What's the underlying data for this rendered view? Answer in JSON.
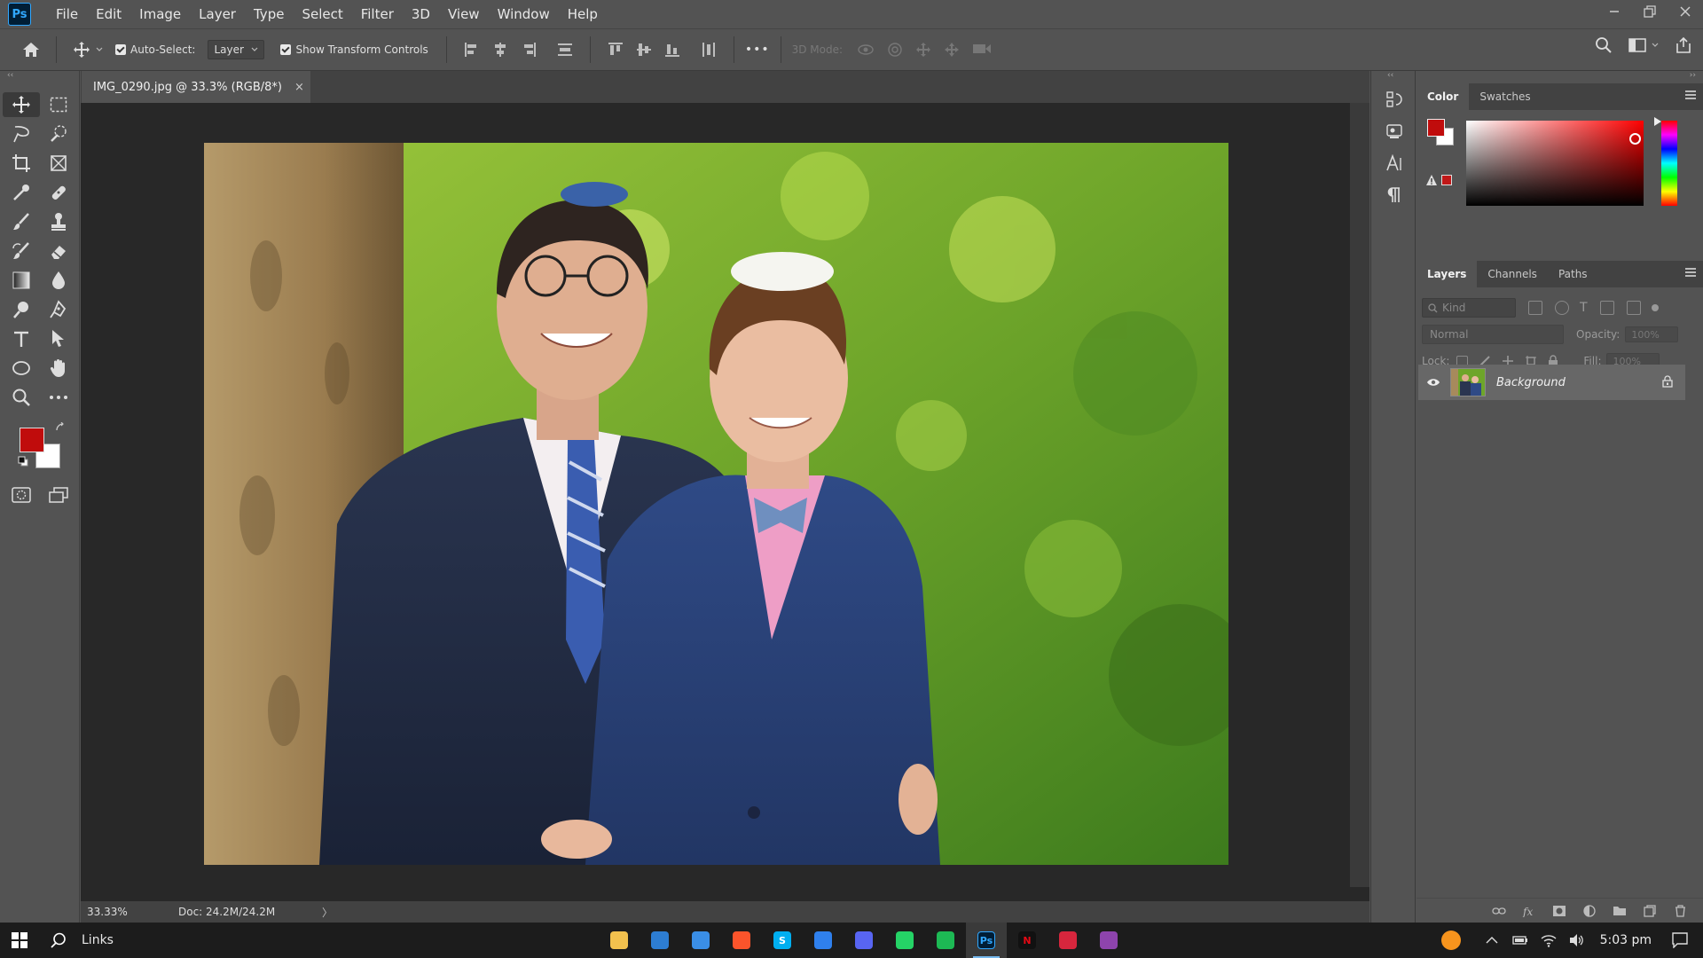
{
  "app": {
    "logo_text": "Ps",
    "menu": [
      "File",
      "Edit",
      "Image",
      "Layer",
      "Type",
      "Select",
      "Filter",
      "3D",
      "View",
      "Window",
      "Help"
    ]
  },
  "options_bar": {
    "auto_select_label": "Auto-Select:",
    "auto_select_checked": true,
    "auto_select_target": "Layer",
    "transform_controls_label": "Show Transform Controls",
    "transform_controls_checked": true,
    "more_label": "•••",
    "mode_3d_label": "3D Mode:"
  },
  "document": {
    "tab_title": "IMG_0290.jpg @ 33.3% (RGB/8*)",
    "close_glyph": "×",
    "zoom": "33.33%",
    "doc_size": "Doc: 24.2M/24.2M",
    "status_arrow": "〉"
  },
  "colors": {
    "foreground": "#c00c0c",
    "background": "#ffffff"
  },
  "color_panel": {
    "tabs": [
      "Color",
      "Swatches"
    ],
    "active_tab": "Color"
  },
  "layers_panel": {
    "tabs": [
      "Layers",
      "Channels",
      "Paths"
    ],
    "active_tab": "Layers",
    "kind_placeholder": "Kind",
    "blend_mode": "Normal",
    "opacity_label": "Opacity:",
    "opacity_value": "100%",
    "lock_label": "Lock:",
    "fill_label": "Fill:",
    "fill_value": "100%",
    "layers": [
      {
        "name": "Background",
        "visible": true,
        "locked": true
      }
    ]
  },
  "taskbar": {
    "search_label": "Links",
    "apps": [
      {
        "name": "file-explorer",
        "color": "#f2c14e",
        "glyph": ""
      },
      {
        "name": "microsoft-store",
        "color": "#2d7dd2",
        "glyph": ""
      },
      {
        "name": "mail",
        "color": "#3a8ee6",
        "glyph": ""
      },
      {
        "name": "brave",
        "color": "#fb542b",
        "glyph": ""
      },
      {
        "name": "skype",
        "color": "#00aff0",
        "glyph": "S"
      },
      {
        "name": "vscode",
        "color": "#2f80ed",
        "glyph": ""
      },
      {
        "name": "discord",
        "color": "#5865f2",
        "glyph": ""
      },
      {
        "name": "whatsapp",
        "color": "#25d366",
        "glyph": ""
      },
      {
        "name": "spotify",
        "color": "#1db954",
        "glyph": ""
      },
      {
        "name": "photoshop",
        "color": "#001e36",
        "glyph": "Ps"
      },
      {
        "name": "netflix",
        "color": "#111111",
        "glyph": "N"
      },
      {
        "name": "inkdrop",
        "color": "#d7263d",
        "glyph": ""
      },
      {
        "name": "app-purple",
        "color": "#8e44ad",
        "glyph": ""
      }
    ],
    "time": "5:03 pm"
  }
}
